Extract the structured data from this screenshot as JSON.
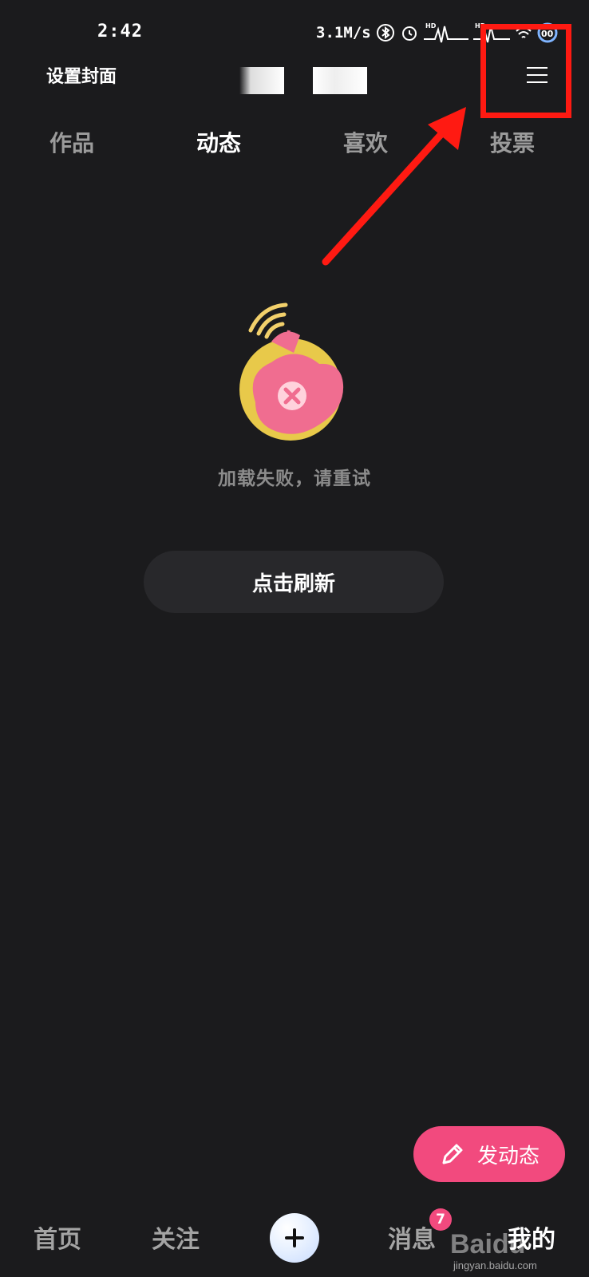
{
  "status_bar": {
    "time": "2:42",
    "net_speed": "3.1M/s",
    "icons": [
      "bluetooth-icon",
      "alarm-icon",
      "hd-signal-icon",
      "hd-signal-icon",
      "wifi-icon",
      "battery-icon"
    ]
  },
  "header": {
    "set_cover_label": "设置封面",
    "menu_icon": "hamburger-menu-icon"
  },
  "annotation": {
    "highlight_color": "#ff1a12",
    "arrow_color": "#ff1a12"
  },
  "tabs": [
    {
      "label": "作品",
      "active": false
    },
    {
      "label": "动态",
      "active": true
    },
    {
      "label": "喜欢",
      "active": false
    },
    {
      "label": "投票",
      "active": false
    }
  ],
  "empty_state": {
    "message": "加载失败，请重试",
    "refresh_label": "点击刷新",
    "illustration": "broken-satellite-icon"
  },
  "post_button": {
    "label": "发动态",
    "icon": "pencil-icon",
    "color": "#f24a7e"
  },
  "bottom_nav": {
    "home": "首页",
    "follow": "关注",
    "create_icon": "plus-icon",
    "messages": "消息",
    "messages_badge": "7",
    "me": "我的"
  },
  "watermark": {
    "brand": "Baidu",
    "url": "jingyan.baidu.com"
  }
}
